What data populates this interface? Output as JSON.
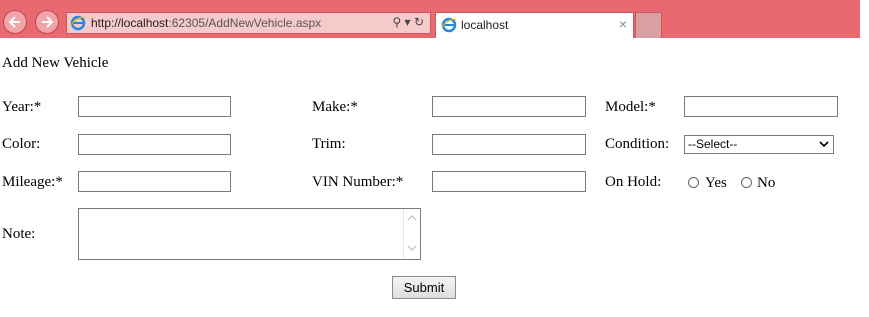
{
  "browser": {
    "url_host": "http://localhost",
    "url_rest": ":62305/AddNewVehicle.aspx",
    "tab_title": "localhost",
    "tab_close": "×",
    "search_glyph": "⚲ ▾",
    "refresh_glyph": "↻"
  },
  "form": {
    "title": "Add New Vehicle",
    "year_label": "Year:*",
    "make_label": "Make:*",
    "model_label": "Model:*",
    "color_label": "Color:",
    "trim_label": "Trim:",
    "condition_label": "Condition:",
    "condition_value": "--Select--",
    "mileage_label": "Mileage:*",
    "vin_label": "VIN Number:*",
    "onhold_label": "On Hold:",
    "yes_label": "Yes",
    "no_label": "No",
    "note_label": "Note:",
    "submit_label": "Submit"
  }
}
